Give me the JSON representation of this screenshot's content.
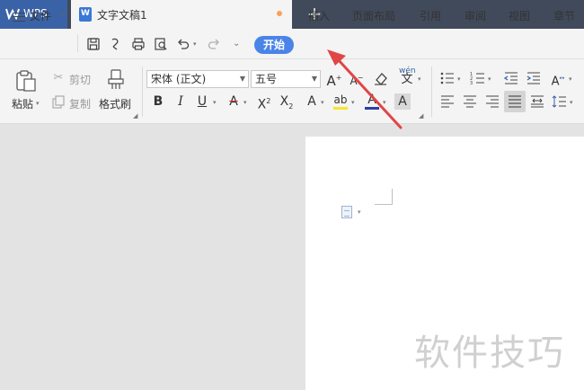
{
  "app": {
    "brand": "WPS"
  },
  "tabs": [
    {
      "label": "文字文稿1",
      "modified": true
    }
  ],
  "new_tab_symbol": "+",
  "menu": {
    "file": "文件",
    "items": [
      "开始",
      "插入",
      "页面布局",
      "引用",
      "审阅",
      "视图",
      "章节"
    ],
    "active": "开始"
  },
  "ribbon": {
    "paste": "粘贴",
    "cut": "剪切",
    "copy": "复制",
    "format_painter": "格式刷",
    "font_name": "宋体 (正文)",
    "font_size": "五号",
    "phonetic": "wén"
  },
  "watermark": "软件技巧",
  "colors": {
    "tabbar": "#414a5a",
    "brand_tab": "#3a62a6",
    "active_tab": "#4a84e8",
    "annotation_arrow": "#e04646",
    "highlight": "#f5e72b",
    "font_color": "#2c3ea8"
  },
  "icons": [
    "wps-logo",
    "doc-icon",
    "save-icon",
    "undo-icon",
    "redo-icon",
    "print-icon",
    "preview-icon",
    "bold-icon",
    "italic-icon",
    "underline-icon"
  ]
}
